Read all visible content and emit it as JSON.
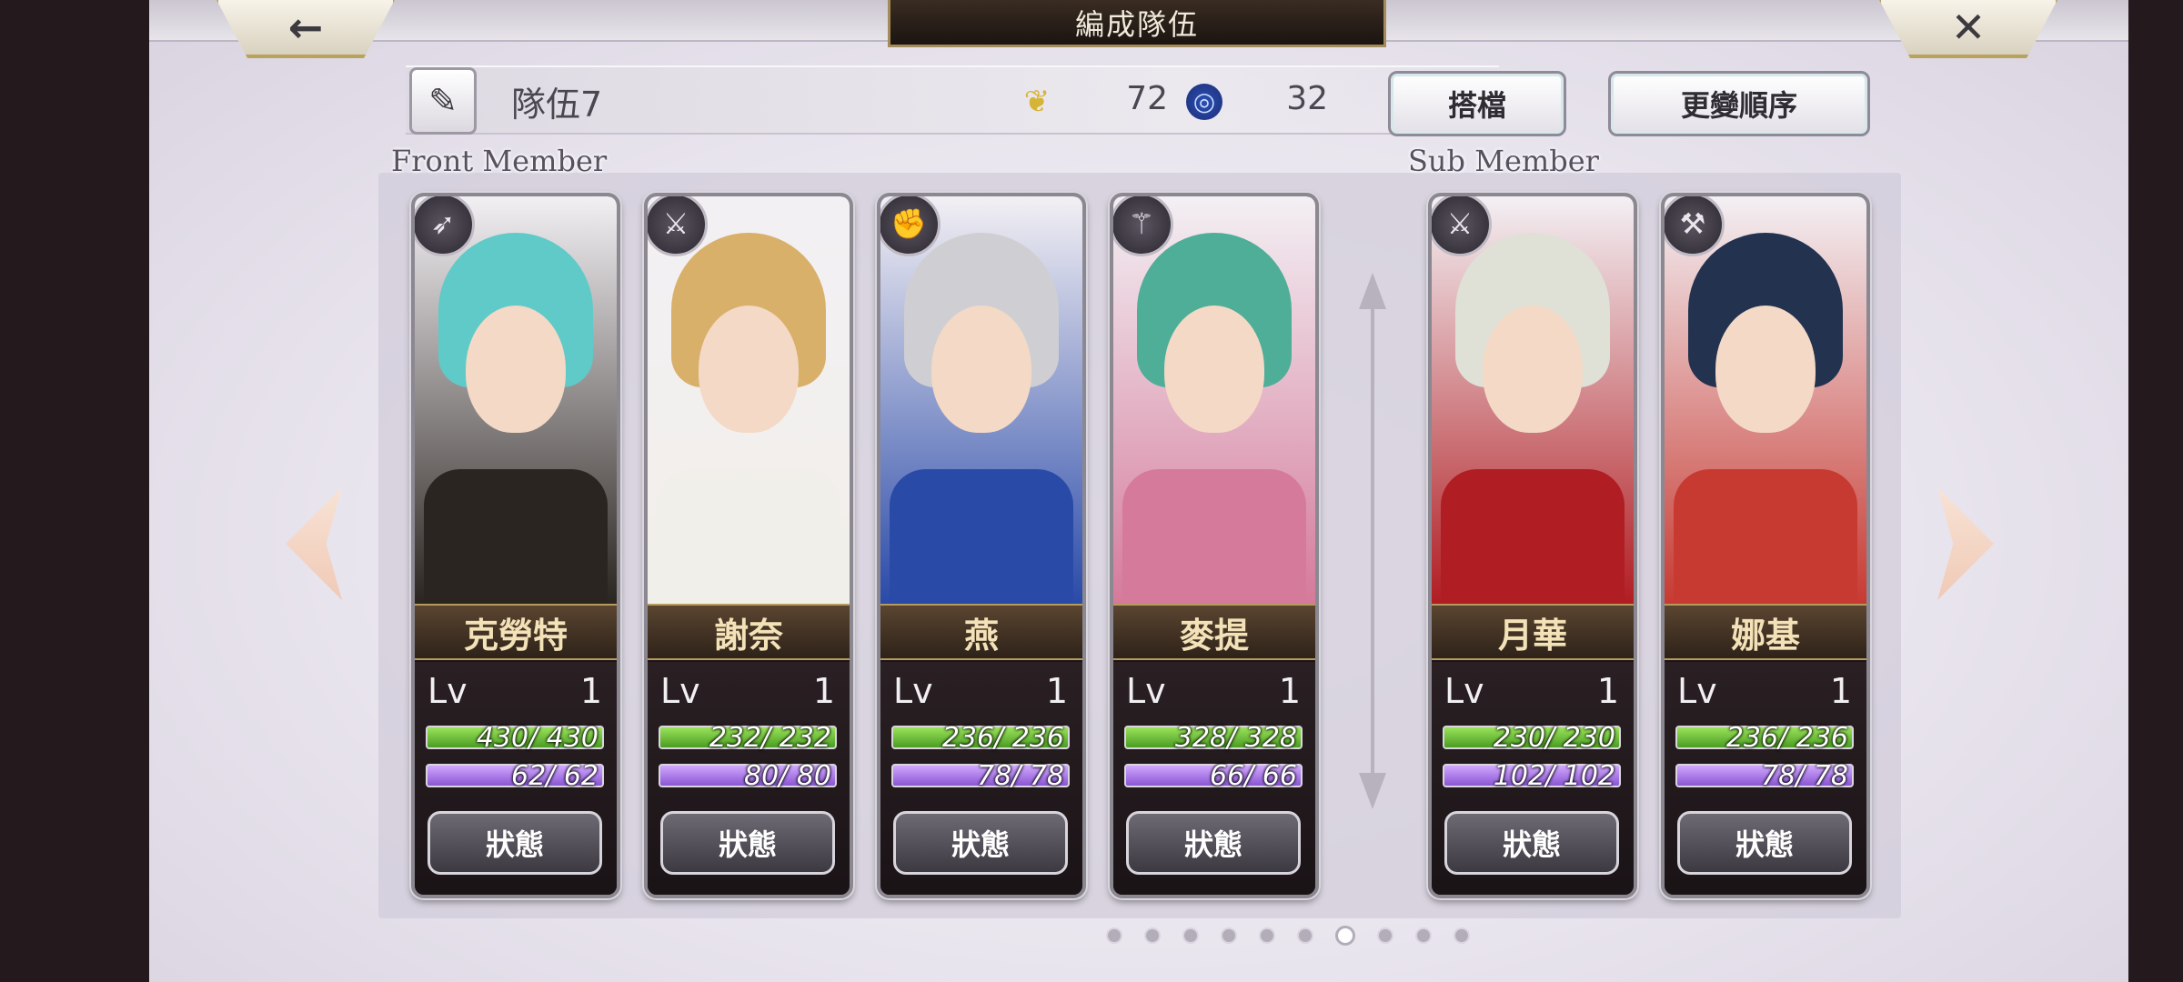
{
  "header": {
    "title": "編成隊伍",
    "back_icon": "←",
    "close_icon": "✕"
  },
  "team": {
    "name": "隊伍7",
    "edit_icon": "✎",
    "wing_icon": "❦",
    "wing_value": "72",
    "swirl_icon": "◎",
    "swirl_value": "32"
  },
  "buttons": {
    "partner": "搭檔",
    "order": "更變順序",
    "status": "狀態"
  },
  "sections": {
    "front": "Front Member",
    "sub": "Sub Member"
  },
  "level_label": "Lv",
  "front_members": [
    {
      "name": "克勞特",
      "weapon": "bow-icon",
      "weapon_glyph": "➶",
      "level": "1",
      "hp": "430/ 430",
      "mp": "62/ 62",
      "hair": "#5fcac8",
      "body": "#2a2520"
    },
    {
      "name": "謝奈",
      "weapon": "sword-icon",
      "weapon_glyph": "⚔",
      "level": "1",
      "hp": "232/ 232",
      "mp": "80/ 80",
      "hair": "#d9b06a",
      "body": "#f1efe9"
    },
    {
      "name": "燕",
      "weapon": "fist-icon",
      "weapon_glyph": "✊",
      "level": "1",
      "hp": "236/ 236",
      "mp": "78/ 78",
      "hair": "#cfcfd3",
      "body": "#2a4aa8"
    },
    {
      "name": "麥提",
      "weapon": "staff-icon",
      "weapon_glyph": "⚚",
      "level": "1",
      "hp": "328/ 328",
      "mp": "66/ 66",
      "hair": "#4fae98",
      "body": "#d57a9a"
    }
  ],
  "sub_members": [
    {
      "name": "月華",
      "weapon": "katana-icon",
      "weapon_glyph": "⚔",
      "level": "1",
      "hp": "230/ 230",
      "mp": "102/ 102",
      "hair": "#dfe0d6",
      "body": "#b01d22"
    },
    {
      "name": "娜基",
      "weapon": "axe-icon",
      "weapon_glyph": "⚒",
      "level": "1",
      "hp": "236/ 236",
      "mp": "78/ 78",
      "hair": "#22324f",
      "body": "#c73a32"
    }
  ],
  "pagination": {
    "total": 10,
    "active_index": 6
  }
}
